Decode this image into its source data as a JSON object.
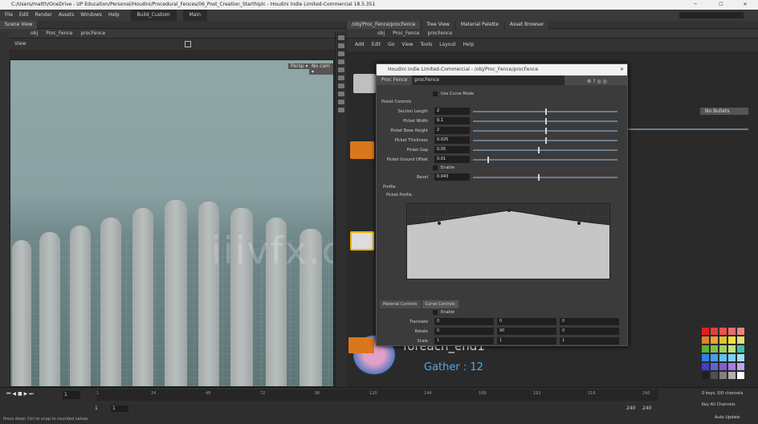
{
  "window": {
    "title": "C:/Users/matth/OneDrive - UP Education/Personal/Houdini/Procedural_Fences/06_Post_Creation_Starthiplc - Houdini Indie Limited-Commercial 18.5.351"
  },
  "menu": [
    "File",
    "Edit",
    "Render",
    "Assets",
    "Windows",
    "Help"
  ],
  "desktop": {
    "build": "Build_Custom",
    "main": "Main"
  },
  "left_pane": {
    "tab": "Scene View",
    "path": [
      "obj",
      "Proc_Fence",
      "procFence"
    ],
    "view_label": "View",
    "persp": "Persp ▾",
    "cam": "No cam ▾"
  },
  "right_pane": {
    "tabs": [
      "/obj/Proc_Fence/procFence",
      "Tree View",
      "Material Palette",
      "Asset Browser"
    ],
    "path": [
      "obj",
      "Proc_Fence",
      "procFence"
    ],
    "menu": [
      "Add",
      "Edit",
      "Go",
      "View",
      "Tools",
      "Layout",
      "Help"
    ],
    "no_bullets": "No Bullets",
    "node_name": "foreach_end1",
    "gather": "Gather : 12"
  },
  "param_window": {
    "title": "Houdini Indie Limited-Commercial - /obj/Proc_Fence/procFence",
    "node_type": "Proc Fence",
    "node_name": "procFence",
    "curve_toggle": "Use Curve Mode",
    "section": "Picket Controls",
    "params": [
      {
        "label": "Section Length",
        "value": "2",
        "frac": 0.5
      },
      {
        "label": "Picket Width",
        "value": "0.1",
        "frac": 0.5
      },
      {
        "label": "Picket Base Height",
        "value": "2",
        "frac": 0.5
      },
      {
        "label": "Picket Thickness",
        "value": "0.025",
        "frac": 0.5
      },
      {
        "label": "Picket Gap",
        "value": "0.05",
        "frac": 0.45
      },
      {
        "label": "Picket Ground Offset",
        "value": "0.01",
        "frac": 0.1
      }
    ],
    "enable_label": "Enable",
    "bevel": {
      "label": "Bevel",
      "value": "0.043",
      "frac": 0.45
    },
    "profile_tab": "Profile",
    "profile_label": "Picket Profile",
    "bottom_tabs": [
      "Material Controls",
      "Curve Controls"
    ],
    "enable2": "Enable",
    "transforms": [
      {
        "label": "Translate",
        "values": [
          "0",
          "0",
          "0"
        ]
      },
      {
        "label": "Rotate",
        "values": [
          "0",
          "90",
          "0"
        ]
      },
      {
        "label": "Scale",
        "values": [
          "1",
          "1",
          "1"
        ]
      }
    ]
  },
  "timeline": {
    "frame": "1",
    "start": "1",
    "start2": "1",
    "end": "240",
    "end2": "240",
    "ticks": [
      "1",
      "24",
      "48",
      "72",
      "96",
      "120",
      "144",
      "168",
      "192",
      "216",
      "240"
    ],
    "keys_label": "0 keys, 0/0 channels",
    "key_all": "Key All Channels",
    "auto_update": "Auto Update",
    "status": "Press down Ctrl to snap to rounded values"
  },
  "watermark": "iiivfx.com",
  "colors": {
    "viewport_sky": "#8fa7a6",
    "picket": "#b3b9b8",
    "accent_orange": "#d9771d",
    "node_blue": "#5aa7e0"
  }
}
